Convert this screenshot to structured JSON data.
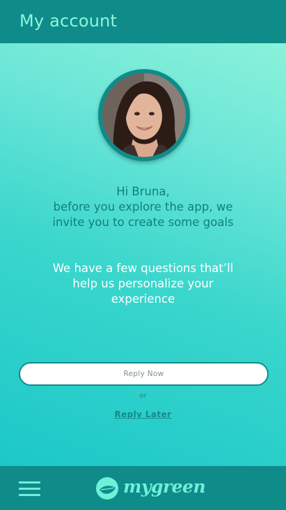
{
  "header": {
    "title": "My account"
  },
  "profile": {
    "avatar_icon": "user-photo"
  },
  "greeting": {
    "line1": "Hi Bruna,",
    "line2": "before you explore the app, we",
    "line3": "invite you to create some goals"
  },
  "questions": {
    "line1": "We have a few questions that’ll",
    "line2": "help us personalize your",
    "line3": "experience"
  },
  "actions": {
    "reply_now_label": "Reply Now",
    "or_label": "or",
    "reply_later_label": "Reply Later"
  },
  "footer": {
    "menu_icon": "hamburger-menu-icon",
    "logo_text": "mygreen"
  },
  "colors": {
    "bar": "#0f8c8a",
    "accent": "#6ff0d8",
    "gradient_start": "#1cc8c8",
    "gradient_end": "#8af2da"
  }
}
